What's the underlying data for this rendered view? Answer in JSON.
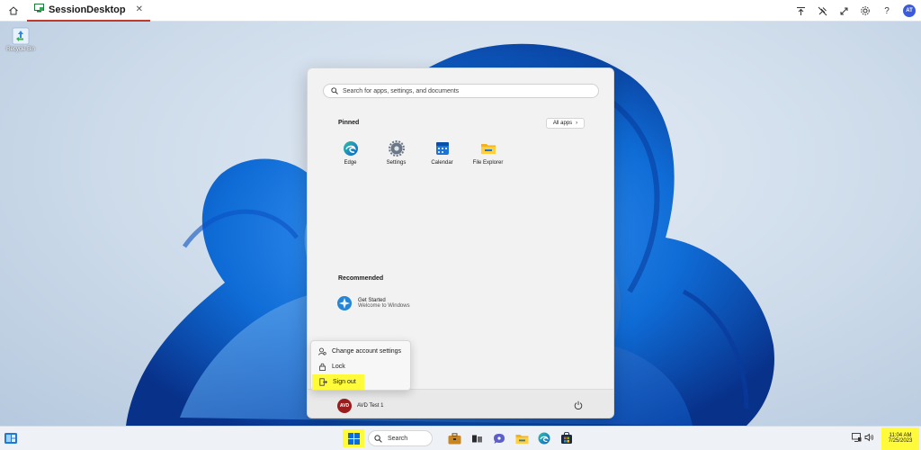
{
  "browser": {
    "tab_label": "SessionDesktop",
    "avatar_initials": "AT",
    "icons": [
      "home-icon",
      "desktop-tab-icon",
      "close-icon",
      "pin-top-icon",
      "unpin-icon",
      "expand-icon",
      "gear-icon",
      "help-icon"
    ]
  },
  "desktop": {
    "recycle_label": "Recycle Bin"
  },
  "start_menu": {
    "search_placeholder": "Search for apps, settings, and documents",
    "pinned_title": "Pinned",
    "all_apps_label": "All apps",
    "apps": [
      {
        "label": "Edge",
        "icon": "edge-icon"
      },
      {
        "label": "Settings",
        "icon": "settings-icon"
      },
      {
        "label": "Calendar",
        "icon": "calendar-icon"
      },
      {
        "label": "File Explorer",
        "icon": "file-explorer-icon"
      }
    ],
    "recommended_title": "Recommended",
    "recommended": [
      {
        "name": "Get Started",
        "desc": "Welcome to Windows",
        "icon": "get-started-icon"
      }
    ],
    "user": {
      "name": "AVD Test 1",
      "avatar_text": "AVD"
    }
  },
  "account_flyout": {
    "items": [
      {
        "label": "Change account settings",
        "icon": "account-settings-icon"
      },
      {
        "label": "Lock",
        "icon": "lock-icon"
      },
      {
        "label": "Sign out",
        "icon": "sign-out-icon",
        "highlighted": true
      }
    ]
  },
  "taskbar": {
    "search_label": "Search",
    "pinned": [
      "briefcase-icon",
      "task-view-icon",
      "chat-icon",
      "file-explorer-icon",
      "edge-icon",
      "store-icon"
    ],
    "clock_time": "11:04 AM",
    "clock_date": "7/25/2023"
  },
  "colors": {
    "highlight": "#fffb3a",
    "windows_blue": "#0f6cd6",
    "tab_underline": "#c0392b"
  }
}
